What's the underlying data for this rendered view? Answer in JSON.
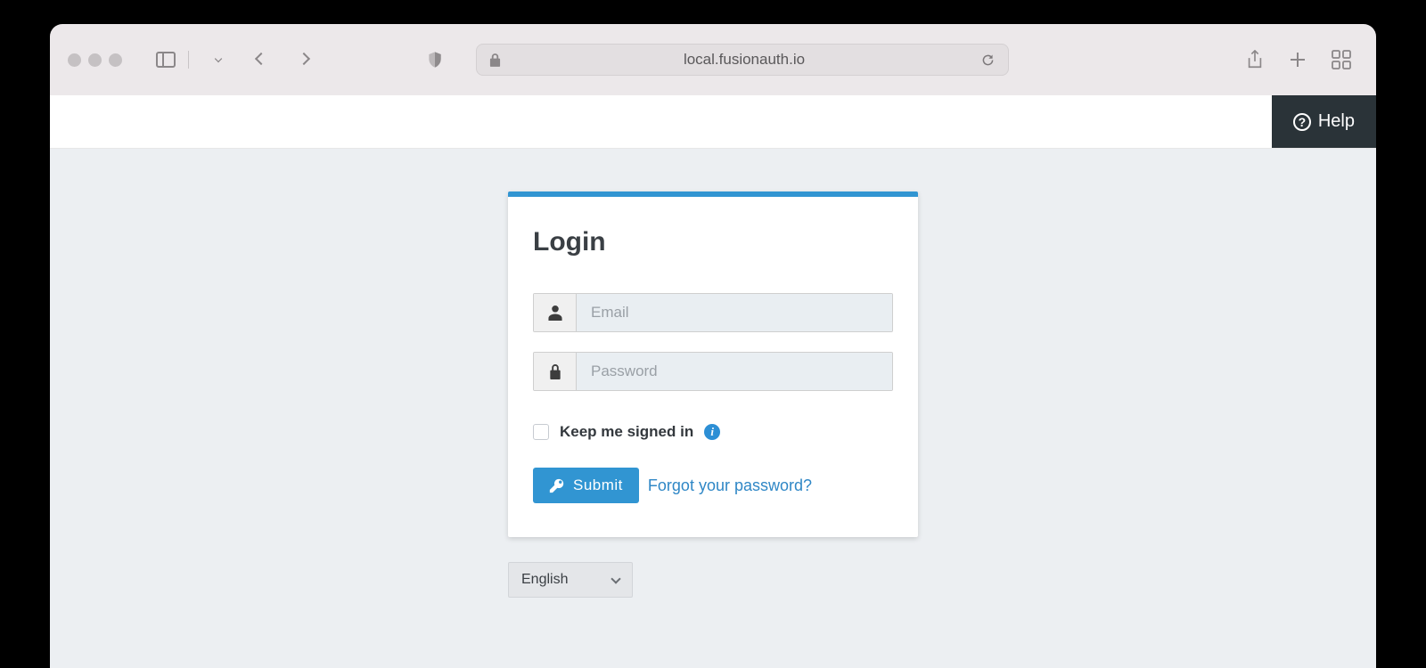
{
  "browser": {
    "url": "local.fusionauth.io"
  },
  "topbar": {
    "help_label": "Help"
  },
  "login": {
    "title": "Login",
    "email_placeholder": "Email",
    "password_placeholder": "Password",
    "remember_label": "Keep me signed in",
    "submit_label": "Submit",
    "forgot_label": "Forgot your password?"
  },
  "language_selector": {
    "value": "English"
  }
}
